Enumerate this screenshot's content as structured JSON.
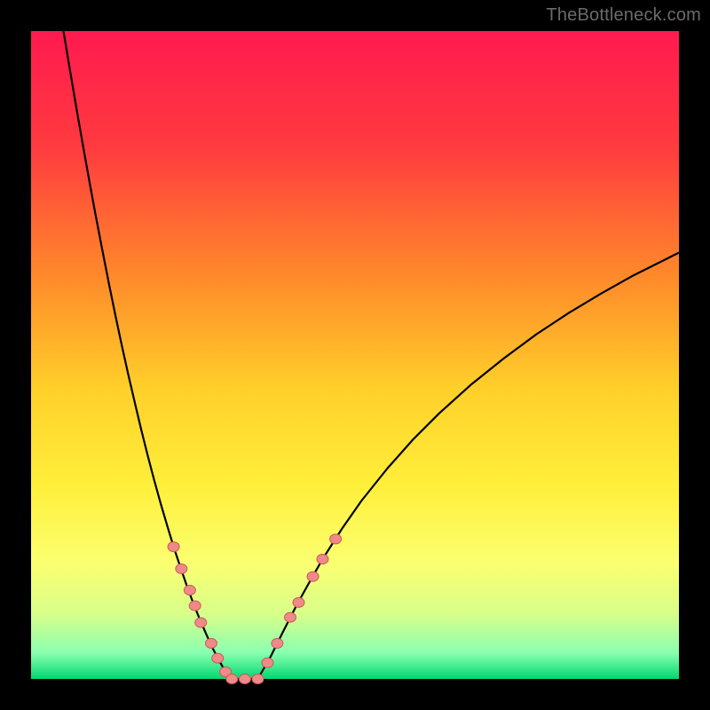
{
  "watermark": "TheBottleneck.com",
  "chart_data": {
    "type": "line",
    "title": "",
    "xlabel": "",
    "ylabel": "",
    "xlim": [
      0,
      100
    ],
    "ylim": [
      0,
      100
    ],
    "background_gradient": {
      "stops": [
        {
          "pos": 0,
          "color": "#ff1a4f"
        },
        {
          "pos": 0.18,
          "color": "#ff3b3f"
        },
        {
          "pos": 0.38,
          "color": "#ff8a2a"
        },
        {
          "pos": 0.55,
          "color": "#ffcf2a"
        },
        {
          "pos": 0.7,
          "color": "#ffef3a"
        },
        {
          "pos": 0.82,
          "color": "#fbff70"
        },
        {
          "pos": 0.9,
          "color": "#d8ff8a"
        },
        {
          "pos": 0.96,
          "color": "#8affb0"
        },
        {
          "pos": 1.0,
          "color": "#00d870"
        }
      ]
    },
    "series": [
      {
        "name": "left-branch",
        "color": "#000000",
        "width": 2.2,
        "x": [
          5.0,
          6.0,
          7.0,
          8.0,
          9.0,
          10.0,
          11.0,
          12.0,
          13.0,
          14.0,
          15.0,
          16.0,
          17.0,
          18.0,
          19.0,
          20.0,
          21.0,
          22.0,
          23.0,
          24.0,
          25.0,
          26.0,
          27.0,
          28.0,
          29.0,
          30.0,
          31.0
        ],
        "y": [
          100.0,
          94.0,
          88.1,
          82.4,
          76.8,
          71.4,
          66.2,
          61.1,
          56.2,
          51.5,
          47.0,
          42.7,
          38.5,
          34.5,
          30.7,
          27.1,
          23.7,
          20.4,
          17.4,
          14.5,
          11.8,
          9.3,
          7.0,
          4.8,
          2.9,
          1.1,
          0.0
        ]
      },
      {
        "name": "floor",
        "color": "#000000",
        "width": 2.2,
        "x": [
          31.0,
          33.0,
          35.0
        ],
        "y": [
          0.0,
          0.0,
          0.0
        ]
      },
      {
        "name": "right-branch",
        "color": "#000000",
        "width": 2.2,
        "x": [
          35.0,
          37.0,
          39.0,
          41.0,
          43.0,
          45.0,
          48.0,
          51.0,
          55.0,
          59.0,
          63.0,
          68.0,
          73.0,
          78.0,
          83.0,
          88.0,
          93.0,
          98.0,
          100.0
        ],
        "y": [
          0.0,
          3.5,
          7.5,
          11.4,
          15.0,
          18.5,
          23.2,
          27.5,
          32.5,
          37.0,
          41.0,
          45.5,
          49.5,
          53.2,
          56.5,
          59.5,
          62.3,
          64.8,
          65.8
        ]
      }
    ],
    "markers": {
      "color": "#f08a88",
      "stroke": "#c85a58",
      "rx": 6.5,
      "ry": 5.5,
      "points": [
        {
          "x": 22.0,
          "y": 20.4
        },
        {
          "x": 23.2,
          "y": 17.0
        },
        {
          "x": 24.5,
          "y": 13.7
        },
        {
          "x": 25.3,
          "y": 11.3
        },
        {
          "x": 26.2,
          "y": 8.7
        },
        {
          "x": 27.8,
          "y": 5.5
        },
        {
          "x": 28.8,
          "y": 3.2
        },
        {
          "x": 30.0,
          "y": 1.1
        },
        {
          "x": 31.0,
          "y": 0.0
        },
        {
          "x": 33.0,
          "y": 0.0
        },
        {
          "x": 35.0,
          "y": 0.0
        },
        {
          "x": 36.5,
          "y": 2.5
        },
        {
          "x": 38.0,
          "y": 5.5
        },
        {
          "x": 40.0,
          "y": 9.5
        },
        {
          "x": 41.3,
          "y": 11.8
        },
        {
          "x": 43.5,
          "y": 15.8
        },
        {
          "x": 45.0,
          "y": 18.5
        },
        {
          "x": 47.0,
          "y": 21.6
        }
      ]
    }
  }
}
